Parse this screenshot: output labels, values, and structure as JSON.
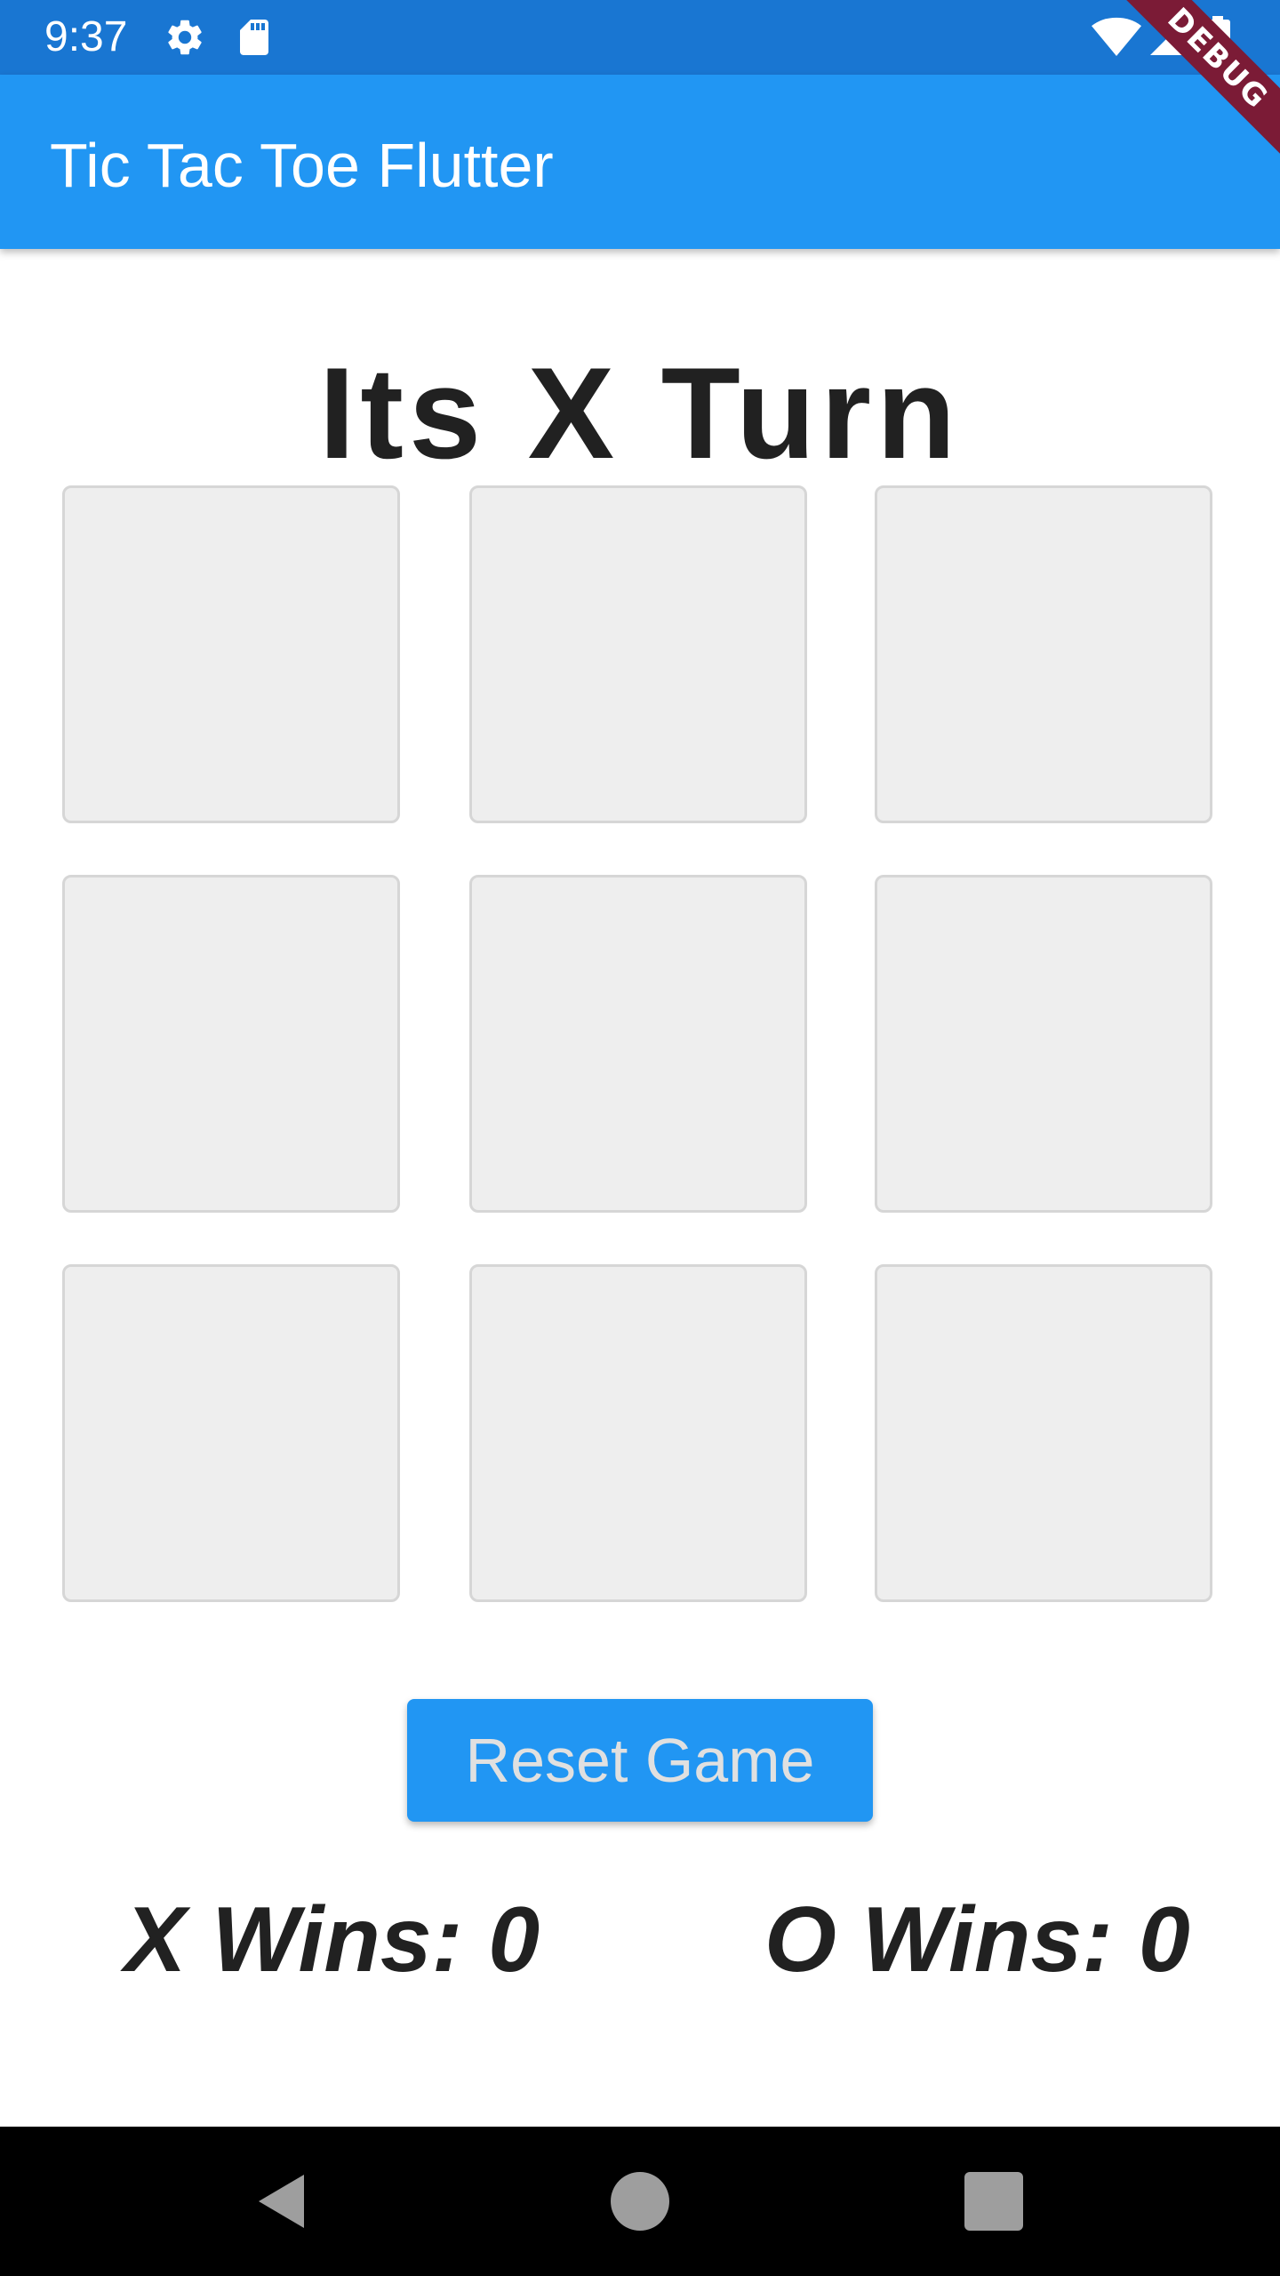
{
  "status_bar": {
    "time": "9:37",
    "icons": [
      "settings-icon",
      "sd-card-icon",
      "wifi-icon",
      "signal-icon",
      "battery-icon"
    ]
  },
  "app_bar": {
    "title": "Tic Tac Toe Flutter"
  },
  "debug_banner": "DEBUG",
  "game": {
    "turn_text": "Its X Turn",
    "board": [
      "",
      "",
      "",
      "",
      "",
      "",
      "",
      "",
      ""
    ],
    "reset_label": "Reset Game",
    "x_score_text": "X Wins: 0",
    "o_score_text": "O Wins: 0"
  },
  "nav_bar": {
    "icons": [
      "back-icon",
      "home-icon",
      "recents-icon"
    ]
  },
  "colors": {
    "status_bar": "#1976D2",
    "app_bar": "#2196F3",
    "cell_fill": "#EEEEEE",
    "cell_border": "#D6D6D6",
    "text_dark": "#212121",
    "button_text": "#E0E0E0",
    "debug_banner": "#7B1B36"
  }
}
